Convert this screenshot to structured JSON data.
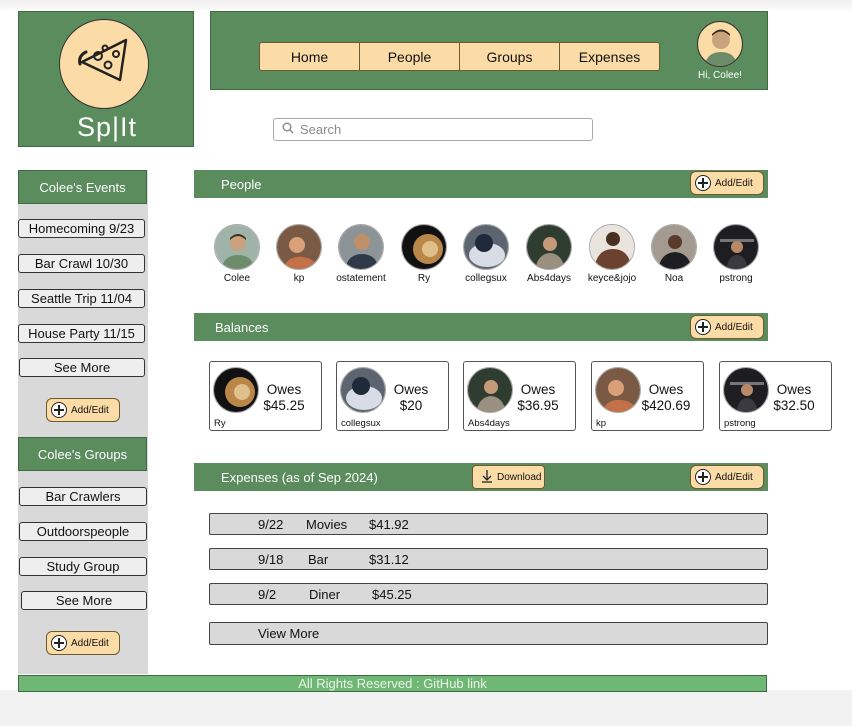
{
  "app": {
    "logo_text": "Sp|It"
  },
  "nav": {
    "items": [
      "Home",
      "People",
      "Groups",
      "Expenses"
    ],
    "greeting": "Hi, Colee!"
  },
  "search": {
    "placeholder": "Search"
  },
  "sidebar": {
    "events_title": "Colee's Events",
    "events": [
      "Homecoming 9/23",
      "Bar Crawl 10/30",
      "Seattle Trip 11/04",
      "House Party 11/15"
    ],
    "events_see_more": "See More",
    "events_add_edit": "Add/Edit",
    "groups_title": "Colee's Groups",
    "groups": [
      "Bar Crawlers",
      "Outdoorspeople",
      "Study Group"
    ],
    "groups_see_more": "See More",
    "groups_add_edit": "Add/Edit"
  },
  "people": {
    "title": "People",
    "add_edit": "Add/Edit",
    "list": [
      "Colee",
      "kp",
      "ostatement",
      "Ry",
      "collegsux",
      "Abs4days",
      "keyce&jojo",
      "Noa",
      "pstrong"
    ]
  },
  "balances": {
    "title": "Balances",
    "add_edit": "Add/Edit",
    "owes_label": "Owes",
    "items": [
      {
        "name": "Ry",
        "amount": "$45.25"
      },
      {
        "name": "collegsux",
        "amount": "$20"
      },
      {
        "name": "Abs4days",
        "amount": "$36.95"
      },
      {
        "name": "kp",
        "amount": "$420.69"
      },
      {
        "name": "pstrong",
        "amount": "$32.50"
      }
    ]
  },
  "expenses": {
    "title": "Expenses (as of Sep 2024)",
    "download_label": "Download",
    "add_edit": "Add/Edit",
    "rows": [
      {
        "date": "9/22",
        "desc": "Movies",
        "amount": "$41.92"
      },
      {
        "date": "9/18",
        "desc": "Bar",
        "amount": "$31.12"
      },
      {
        "date": "9/2",
        "desc": "Diner",
        "amount": "$45.25"
      }
    ],
    "view_more": "View More"
  },
  "footer": {
    "text": "All Rights Reserved : GitHub link"
  },
  "colors": {
    "green": "#5b8c5e",
    "cream": "#fcdca6",
    "sidebar_gray": "#d9d9d9",
    "footer_green": "#6fb774"
  }
}
